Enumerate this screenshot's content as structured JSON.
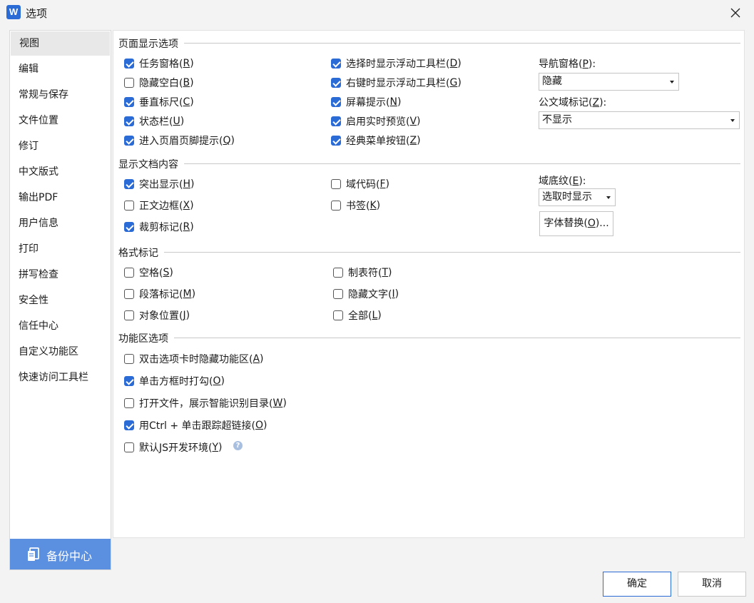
{
  "window": {
    "title": "选项",
    "app_icon_letter": "W"
  },
  "sidebar": {
    "items": [
      {
        "label": "视图"
      },
      {
        "label": "编辑"
      },
      {
        "label": "常规与保存"
      },
      {
        "label": "文件位置"
      },
      {
        "label": "修订"
      },
      {
        "label": "中文版式"
      },
      {
        "label": "输出PDF"
      },
      {
        "label": "用户信息"
      },
      {
        "label": "打印"
      },
      {
        "label": "拼写检查"
      },
      {
        "label": "安全性"
      },
      {
        "label": "信任中心"
      },
      {
        "label": "自定义功能区"
      },
      {
        "label": "快速访问工具栏"
      }
    ],
    "selected": "视图",
    "backup_label": "备份中心"
  },
  "page_display": {
    "title": "页面显示选项",
    "col1": [
      {
        "text": "任务窗格(",
        "key": "R",
        "tail": ")",
        "checked": true
      },
      {
        "text": "隐藏空白(",
        "key": "B",
        "tail": ")",
        "checked": false
      },
      {
        "text": "垂直标尺(",
        "key": "C",
        "tail": ")",
        "checked": true
      },
      {
        "text": "状态栏(",
        "key": "U",
        "tail": ")",
        "checked": true
      },
      {
        "text": "进入页眉页脚提示(",
        "key": "Q",
        "tail": ")",
        "checked": true
      }
    ],
    "col2": [
      {
        "text": "选择时显示浮动工具栏(",
        "key": "D",
        "tail": ")",
        "checked": true
      },
      {
        "text": "右键时显示浮动工具栏(",
        "key": "G",
        "tail": ")",
        "checked": true
      },
      {
        "text": "屏幕提示(",
        "key": "N",
        "tail": ")",
        "checked": true
      },
      {
        "text": "启用实时预览(",
        "key": "V",
        "tail": ")",
        "checked": true
      },
      {
        "text": "经典菜单按钮(",
        "key": "Z",
        "tail": ")",
        "checked": true
      }
    ],
    "nav_pane": {
      "text": "导航窗格(",
      "key": "P",
      "tail": "):",
      "value": "隐藏"
    },
    "field_mark": {
      "text": "公文域标记(",
      "key": "Z",
      "tail": "):",
      "value": "不显示"
    }
  },
  "doc_content": {
    "title": "显示文档内容",
    "col1": [
      {
        "text": "突出显示(",
        "key": "H",
        "tail": ")",
        "checked": true
      },
      {
        "text": "正文边框(",
        "key": "X",
        "tail": ")",
        "checked": false
      },
      {
        "text": "裁剪标记(",
        "key": "R",
        "tail": ")",
        "checked": true
      }
    ],
    "col2": [
      {
        "text": "域代码(",
        "key": "F",
        "tail": ")",
        "checked": false
      },
      {
        "text": "书签(",
        "key": "K",
        "tail": ")",
        "checked": false
      }
    ],
    "field_shading": {
      "text": "域底纹(",
      "key": "E",
      "tail": "):",
      "value": "选取时显示"
    },
    "font_sub": {
      "text": "字体替换(",
      "key": "O",
      "tail": ")..."
    }
  },
  "format_marks": {
    "title": "格式标记",
    "col1": [
      {
        "text": "空格(",
        "key": "S",
        "tail": ")",
        "checked": false
      },
      {
        "text": "段落标记(",
        "key": "M",
        "tail": ")",
        "checked": false
      },
      {
        "text": "对象位置(",
        "key": "J",
        "tail": ")",
        "checked": false
      }
    ],
    "col2": [
      {
        "text": "制表符(",
        "key": "T",
        "tail": ")",
        "checked": false
      },
      {
        "text": "隐藏文字(",
        "key": "I",
        "tail": ")",
        "checked": false
      },
      {
        "text": "全部(",
        "key": "L",
        "tail": ")",
        "checked": false
      }
    ]
  },
  "ribbon": {
    "title": "功能区选项",
    "items": [
      {
        "text": "双击选项卡时隐藏功能区(",
        "key": "A",
        "tail": ")",
        "checked": false
      },
      {
        "text": "单击方框时打勾(",
        "key": "O",
        "tail": ")",
        "checked": true
      },
      {
        "text": "打开文件，展示智能识别目录(",
        "key": "W",
        "tail": ")",
        "checked": false
      },
      {
        "text": "用Ctrl + 单击跟踪超链接(",
        "key": "O",
        "tail": ")",
        "checked": true
      },
      {
        "text": "默认JS开发环境(",
        "key": "Y",
        "tail": ")",
        "checked": false
      }
    ],
    "help_glyph": "?"
  },
  "footer": {
    "ok_label": "确定",
    "cancel_label": "取消"
  }
}
